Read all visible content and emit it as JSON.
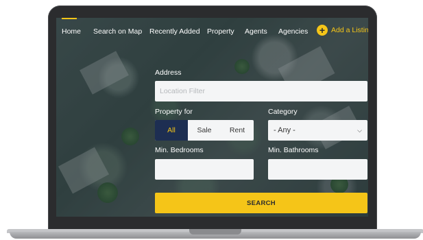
{
  "nav": {
    "items": [
      "Home",
      "Search on Map",
      "Recently Added",
      "Property",
      "Agents",
      "Agencies"
    ],
    "add_listing": "Add a Listing",
    "add_icon": "plus-circle-icon"
  },
  "form": {
    "address_label": "Address",
    "address_placeholder": "Location Filter",
    "property_for_label": "Property for",
    "property_for_options": [
      "All",
      "Sale",
      "Rent"
    ],
    "property_for_selected": "All",
    "category_label": "Category",
    "category_value": "- Any -",
    "min_bedrooms_label": "Min. Bedrooms",
    "min_bathrooms_label": "Min. Bathrooms",
    "search_label": "SEARCH"
  },
  "colors": {
    "accent": "#f5c518",
    "active_segment": "#1d2e52",
    "field_bg": "#f4f5f6"
  }
}
